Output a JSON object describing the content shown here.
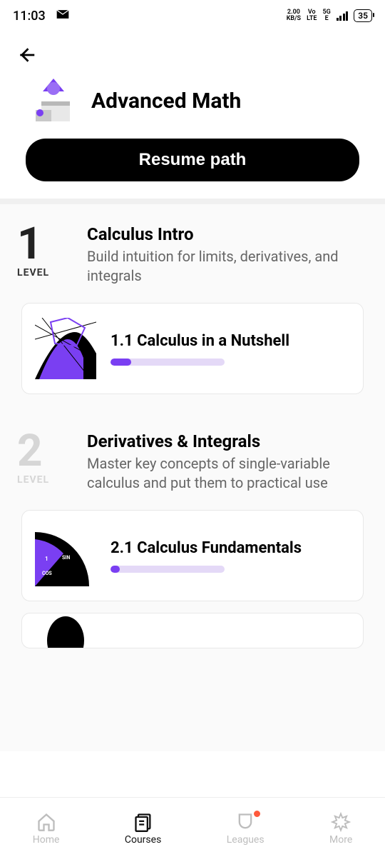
{
  "statusbar": {
    "time": "11:03",
    "net_speed_top": "2.00",
    "net_speed_bottom": "KB/S",
    "volte_top": "Vo",
    "volte_bottom": "LTE",
    "net_type_top": "5G",
    "net_type_bottom": "E",
    "battery": "35"
  },
  "header": {
    "title": "Advanced Math",
    "resume_label": "Resume path"
  },
  "levels": [
    {
      "num": "1",
      "label": "LEVEL",
      "dim": false,
      "title": "Calculus Intro",
      "desc": "Build intuition for limits, derivatives, and integrals",
      "courses": [
        {
          "title": "1.1 Calculus in a Nutshell",
          "progress_pct": 18
        }
      ]
    },
    {
      "num": "2",
      "label": "LEVEL",
      "dim": true,
      "title": "Derivatives & Integrals",
      "desc": "Master key concepts of single-variable calculus and put them to practical use",
      "courses": [
        {
          "title": "2.1 Calculus Fundamentals",
          "progress_pct": 8
        }
      ]
    }
  ],
  "nav": {
    "home": "Home",
    "courses": "Courses",
    "leagues": "Leagues",
    "more": "More",
    "active": "courses"
  },
  "colors": {
    "accent": "#7a3ff2",
    "accent_light": "#e4d9f7"
  }
}
